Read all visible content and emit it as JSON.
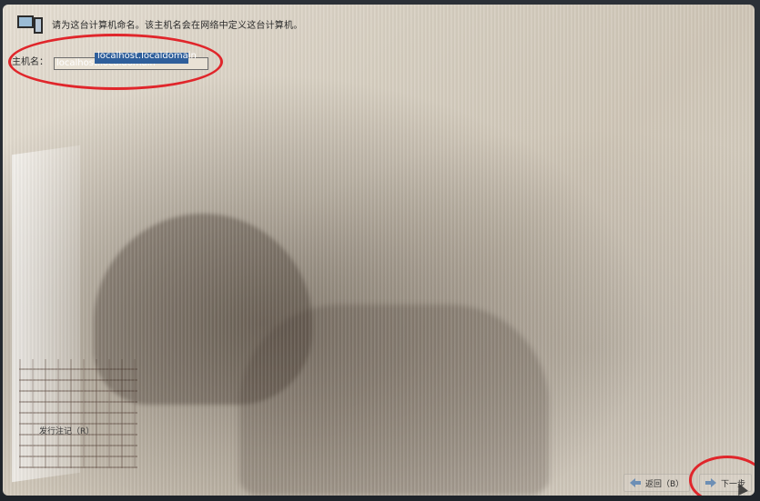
{
  "header": {
    "instruction": "请为这台计算机命名。该主机名会在网络中定义这台计算机。"
  },
  "hostname": {
    "label": "主机名：",
    "value": "localhost.localdomain"
  },
  "release_notes": {
    "label": "发行注记（R）"
  },
  "buttons": {
    "back_label": "返回（B）",
    "next_label": "下一步"
  },
  "colors": {
    "annotation": "#e0262b",
    "selection": "#2f5f9b"
  },
  "icons": {
    "header": "computer-icon",
    "back": "arrow-left-icon",
    "next": "arrow-right-icon",
    "cursor": "mouse-cursor-icon"
  }
}
